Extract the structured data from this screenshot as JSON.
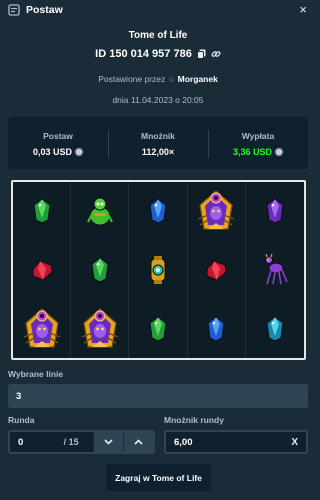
{
  "header": {
    "title": "Postaw",
    "close": "×"
  },
  "game": {
    "name": "Tome of Life",
    "bet_id": "ID 150 014 957 786",
    "placed_by_prefix": "Postawione przez",
    "user": "Morganek",
    "date": "dnia 11.04.2023 o 20:05"
  },
  "stats": {
    "bet_label": "Postaw",
    "bet_value": "0,03 USD",
    "multiplier_label": "Mnożnik",
    "multiplier_value": "112,00×",
    "payout_label": "Wypłata",
    "payout_value": "3,36 USD",
    "payout_color": "#1fff20"
  },
  "reels": [
    [
      "green-gem",
      "potion-creature",
      "blue-gem",
      "golden-pharaoh",
      "purple-gem"
    ],
    [
      "red-gem",
      "green-gem",
      "golden-lantern",
      "red-gem",
      "spider-creature"
    ],
    [
      "golden-pharaoh",
      "golden-pharaoh",
      "green-gem",
      "blue-gem",
      "teal-gem"
    ]
  ],
  "form": {
    "lines_label": "Wybrane linie",
    "lines_value": "3",
    "round_label": "Runda",
    "round_value": "0",
    "round_total": "/ 15",
    "mult_label": "Mnożnik rundy",
    "mult_value": "6,00",
    "mult_clear": "X"
  },
  "play_button": "Zagraj w Tome of Life"
}
